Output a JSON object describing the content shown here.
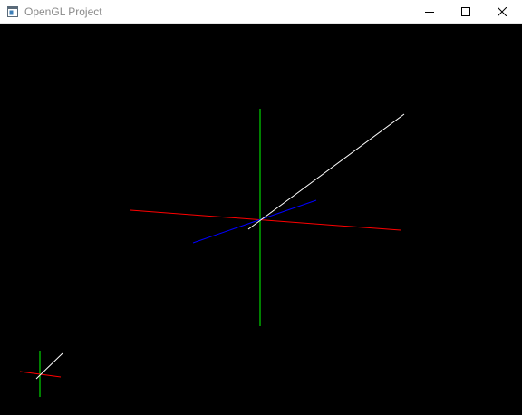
{
  "window": {
    "title": "OpenGL Project",
    "title_color": "#8a8a8a",
    "titlebar_bg": "#ffffff",
    "controls": [
      {
        "name": "minimize-button",
        "icon": "minimize-icon"
      },
      {
        "name": "maximize-button",
        "icon": "maximize-icon"
      },
      {
        "name": "close-button",
        "icon": "close-icon"
      }
    ]
  },
  "viewport": {
    "background": "#000000",
    "main_axes": {
      "x_axis_color": "#ff0000",
      "y_axis_color": "#00ff00",
      "z_axis_color": "#0000ff",
      "diagonal_color": "#ffffff"
    },
    "mini_axes": {
      "x_axis_color": "#ff0000",
      "y_axis_color": "#00ff00",
      "diagonal_color": "#ffffff"
    }
  }
}
